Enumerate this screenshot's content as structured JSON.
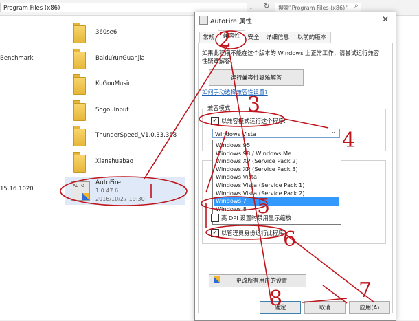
{
  "explorer": {
    "address": "Program Files (x86)",
    "search_placeholder": "搜索\"Program Files (x86)\"",
    "left_labels": [
      "Benchmark",
      "15.16.1020"
    ],
    "folders": [
      "360se6",
      "BaiduYunGuanjia",
      "KuGouMusic",
      "SogouInput",
      "ThunderSpeed_V1.0.33.358",
      "Xianshuabao"
    ],
    "selected_file": {
      "name": "AutoFire",
      "version": "1.0.47.6",
      "date": "2016/10/27 19:30"
    }
  },
  "dialog": {
    "title": "AutoFire 属性",
    "tabs": [
      "常规",
      "兼容性",
      "安全",
      "详细信息",
      "以前的版本"
    ],
    "active_tab": "兼容性",
    "intro": "如果此程序不能在这个版本的 Windows 上正常工作，请尝试运行兼容性疑难解答。",
    "troubleshoot_button": "运行兼容性疑难解答",
    "manual_link": "如何手动选择兼容性设置?",
    "compat_mode_group": "兼容模式",
    "compat_checkbox": "以兼容模式运行这个程序:",
    "compat_selected": "Windows Vista",
    "compat_options": [
      "Windows 95",
      "Windows 98 / Windows Me",
      "Windows XP (Service Pack 2)",
      "Windows XP (Service Pack 3)",
      "Windows Vista",
      "Windows Vista (Service Pack 1)",
      "Windows Vista (Service Pack 2)",
      "Windows 7",
      "Windows 8"
    ],
    "compat_highlighted": "Windows 7",
    "dpi_checkbox": "高 DPI 设置时禁用显示缩放",
    "admin_checkbox": "以管理员身份运行此程序",
    "change_all_button": "更改所有用户的设置",
    "ok_button": "确定",
    "cancel_button": "取消",
    "apply_button": "应用(A)"
  },
  "annotations": [
    "2",
    "3",
    "4",
    "5",
    "6",
    "7",
    "8"
  ],
  "colors": {
    "annotation": "#c0151c",
    "selection": "#3399ff"
  }
}
